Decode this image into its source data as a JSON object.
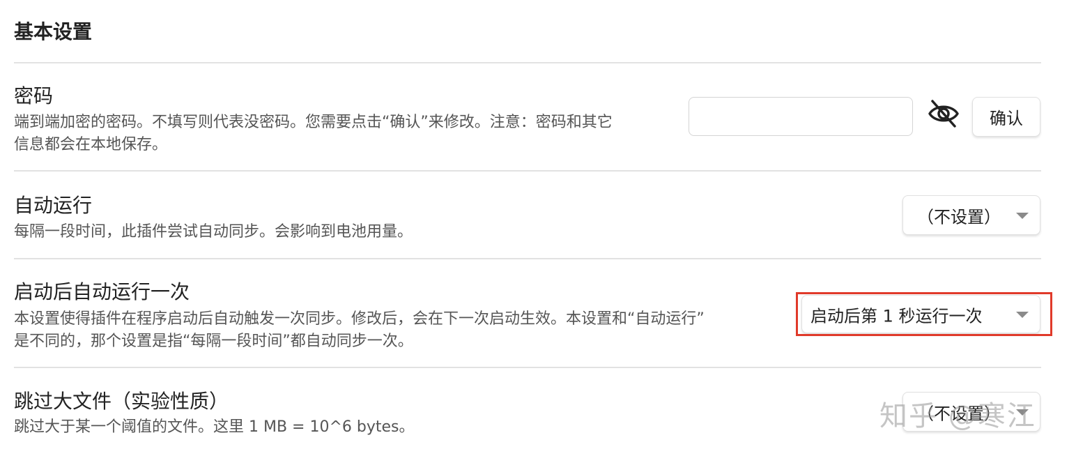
{
  "section": {
    "title": "基本设置"
  },
  "password": {
    "name": "密码",
    "desc_line1": "端到端加密的密码。不填写则代表没密码。您需要点击“确认”来修改。注意：密码和其它",
    "desc_line2": "信息都会在本地保存。",
    "input_value": "",
    "visibility_icon": "eye-slash-icon",
    "confirm_label": "确认"
  },
  "auto_run": {
    "name": "自动运行",
    "desc": "每隔一段时间，此插件尝试自动同步。会影响到电池用量。",
    "selected": "（不设置）"
  },
  "run_on_startup": {
    "name": "启动后自动运行一次",
    "desc_line1": "本设置使得插件在程序启动后自动触发一次同步。修改后，会在下一次启动生效。本设置和“自动运行”",
    "desc_line2": "是不同的，那个设置是指“每隔一段时间”都自动同步一次。",
    "selected": "启动后第 1 秒运行一次",
    "highlight_color": "#e03a2a"
  },
  "skip_large_files": {
    "name": "跳过大文件（实验性质）",
    "desc": "跳过大于某一个阈值的文件。这里 1 MB = 10^6 bytes。",
    "selected": "（不设置）"
  },
  "watermark": {
    "text": "知乎 @寒江"
  }
}
